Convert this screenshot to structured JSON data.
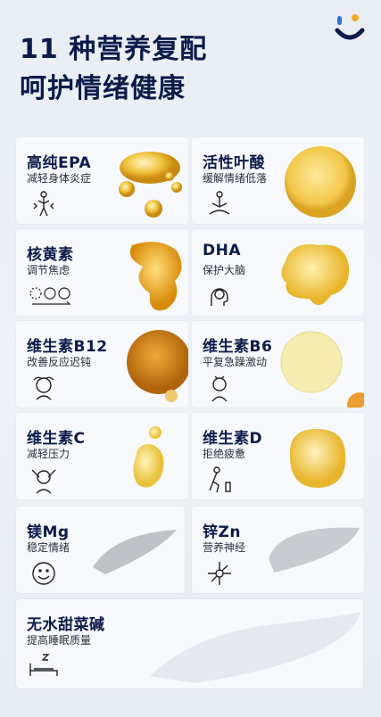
{
  "header": {
    "title_line1": "11 种营养复配",
    "title_line2": "呵护情绪健康"
  },
  "colors": {
    "navy": "#0b1b4a",
    "orange": "#f5a623",
    "blue": "#2f6fe0"
  },
  "items": [
    {
      "name": "高纯EPA",
      "desc": "减轻身体炎症",
      "icon": "pain-body-icon"
    },
    {
      "name": "活性叶酸",
      "desc": "缓解情绪低落",
      "icon": "meditation-icon"
    },
    {
      "name": "核黄素",
      "desc": "调节焦虑",
      "icon": "mood-faces-icon"
    },
    {
      "name": "DHA",
      "desc": "保护大脑",
      "icon": "brain-icon"
    },
    {
      "name": "维生素B12",
      "desc": "改善反应迟钝",
      "icon": "confused-head-icon"
    },
    {
      "name": "维生素B6",
      "desc": "平复急躁激动",
      "icon": "angry-person-icon"
    },
    {
      "name": "维生素C",
      "desc": "减轻压力",
      "icon": "stressed-person-icon"
    },
    {
      "name": "维生素D",
      "desc": "拒绝疲惫",
      "icon": "tired-person-icon"
    },
    {
      "name": "镁Mg",
      "desc": "稳定情绪",
      "icon": "smile-icon"
    },
    {
      "name": "锌Zn",
      "desc": "营养神经",
      "icon": "neuron-icon"
    },
    {
      "name": "无水甜菜碱",
      "desc": "提高睡眠质量",
      "icon": "sleep-icon"
    }
  ]
}
